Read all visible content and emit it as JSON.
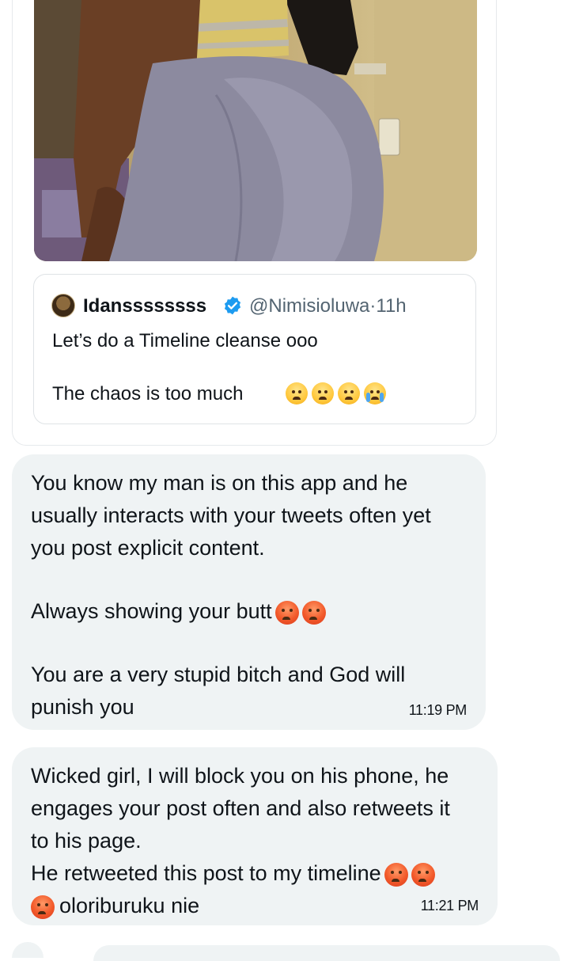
{
  "quoted_tweet": {
    "display_name": "Idanssssssss",
    "handle": "@Nimisioluwa",
    "separator": "·",
    "time_ago": "11h",
    "verified_badge_icon": "verified-badge-icon",
    "line1": "Let’s do a Timeline cleanse ooo",
    "line2": "The chaos is too much",
    "emojis": [
      "face-with-steam-icon",
      "face-with-steam-icon",
      "face-with-steam-icon",
      "loudly-crying-face-icon"
    ]
  },
  "messages": [
    {
      "lines": [
        "You know my man is on this app and he",
        "usually interacts with your tweets often yet",
        "you post explicit content."
      ],
      "line_butt": "Always showing your butt",
      "lines_end": [
        "You are a very stupid bitch and God will",
        "punish you"
      ],
      "time": "11:19 PM"
    },
    {
      "lines": [
        "Wicked girl, I will block you on his phone, he",
        "engages your post often and also retweets it",
        "to his page.",
        "He retweeted this post to my timeline"
      ],
      "last_line": "oloriburuku nie",
      "time": "11:21 PM"
    }
  ],
  "colors": {
    "bubble_bg": "#eff3f4",
    "handle_gray": "#536471",
    "verified_blue": "#1d9bf0"
  }
}
